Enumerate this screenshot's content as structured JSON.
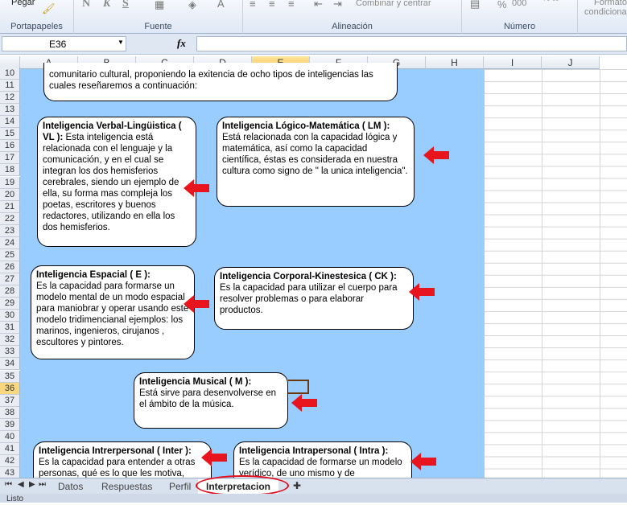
{
  "ribbon": {
    "paste": "Pegar",
    "group_clipboard": "Portapapeles",
    "group_font": "Fuente",
    "group_alignment": "Alineación",
    "group_number": "Número",
    "bold": "N",
    "italic": "K",
    "underline": "S",
    "merge": "Combinar y centrar",
    "percent": "%",
    "thousands": "000",
    "conditional_format_1": "Formato",
    "conditional_format_2": "condicional"
  },
  "formula_bar": {
    "name_box": "E36",
    "fx": "fx",
    "value": ""
  },
  "columns": [
    "A",
    "B",
    "C",
    "D",
    "E",
    "F",
    "G",
    "H",
    "I",
    "J"
  ],
  "selected_column": "E",
  "rows": [
    "10",
    "11",
    "12",
    "13",
    "14",
    "15",
    "16",
    "17",
    "18",
    "19",
    "20",
    "21",
    "22",
    "23",
    "24",
    "25",
    "26",
    "27",
    "28",
    "29",
    "30",
    "31",
    "32",
    "33",
    "34",
    "35",
    "36",
    "37",
    "38",
    "39",
    "40",
    "41",
    "42",
    "43"
  ],
  "selected_row": "36",
  "boxes": {
    "intro": {
      "body": "comunitario cultural, proponiendo la exitencia de ocho tipos de inteligencias las cuales reseñaremos a continuación:"
    },
    "verbal": {
      "title": "Inteligencia Verbal-Lingüistica ( VL ):",
      "body": " Esta inteligencia está relacionada con el lenguaje y la comunicación, y en el cual se integran los dos hemisferios cerebrales, siendo un ejemplo de ella, su forma mas compleja los poetas, escritores y buenos redactores, utilizando en ella los dos hemisferios."
    },
    "logico": {
      "title": "Inteligencia Lógico-Matemática ( LM ):",
      "body": "Está relacionada con la capacidad lógica y matemática, así como la capacidad científica, éstas es considerada en nuestra cultura como signo de \" la unica inteligencia\"."
    },
    "espacial": {
      "title": "Inteligencia Espacial ( E ):",
      "body": "Es la capacidad para formarse un modelo mental de un modo espacial para maniobrar y operar usando este modelo tridimencianal ejemplos: los marinos, ingenieros, cirujanos , escultores y pintores."
    },
    "corporal": {
      "title": "Inteligencia Corporal-Kinestesica ( CK ):",
      "body": "Es la capacidad para utilizar el cuerpo para resolver problemas o para elaborar productos."
    },
    "musical": {
      "title": "Inteligencia Musical ( M ):",
      "body": "Está sirve para desenvolverse en el ámbito de la música."
    },
    "interpersonal": {
      "title": "Inteligencia Intrerpersonal ( Inter ):",
      "body": "Es la capacidad para entender a otras personas, qué es lo que les motiva,"
    },
    "intrapersonal": {
      "title": "Inteligencia Intrapersonal ( Intra ):",
      "body": "Es la capacidad de formarse un modelo verídico, de uno mismo y de"
    }
  },
  "sheet_tabs": [
    {
      "label": "Datos"
    },
    {
      "label": "Respuestas"
    },
    {
      "label": "Perfil"
    },
    {
      "label": "Interpretacion"
    }
  ],
  "active_tab": "Interpretacion",
  "status": "Listo",
  "colors": {
    "fill": "#99ccff",
    "arrow": "#e8141e",
    "highlight_circle": "#e01020"
  }
}
